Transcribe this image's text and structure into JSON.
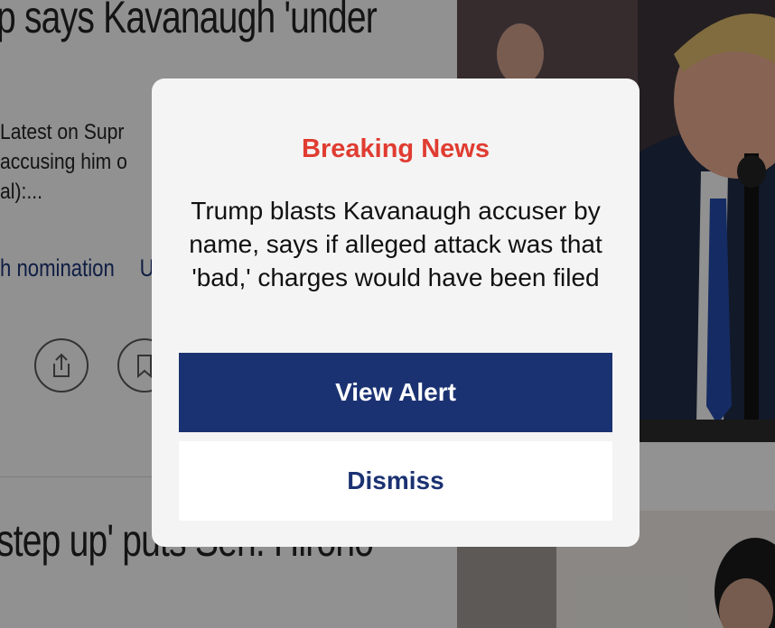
{
  "background": {
    "headline_top": "p says Kavanaugh 'under",
    "summary_lines": [
      "Latest on Supr",
      "accusing him o",
      "al):..."
    ],
    "topic_links": [
      "h nomination",
      "U"
    ],
    "headline_bottom": "step up' puts Sen. Hirono",
    "share_icon": "share-icon",
    "bookmark_icon": "bookmark-icon"
  },
  "alert": {
    "title": "Breaking News",
    "body": "Trump blasts Kavanaugh accuser by name, says if alleged attack was that 'bad,' charges would have been filed",
    "view_label": "View Alert",
    "dismiss_label": "Dismiss"
  },
  "colors": {
    "title_red": "#e03c31",
    "navy": "#1b3272",
    "modal_bg": "#f4f4f4"
  }
}
